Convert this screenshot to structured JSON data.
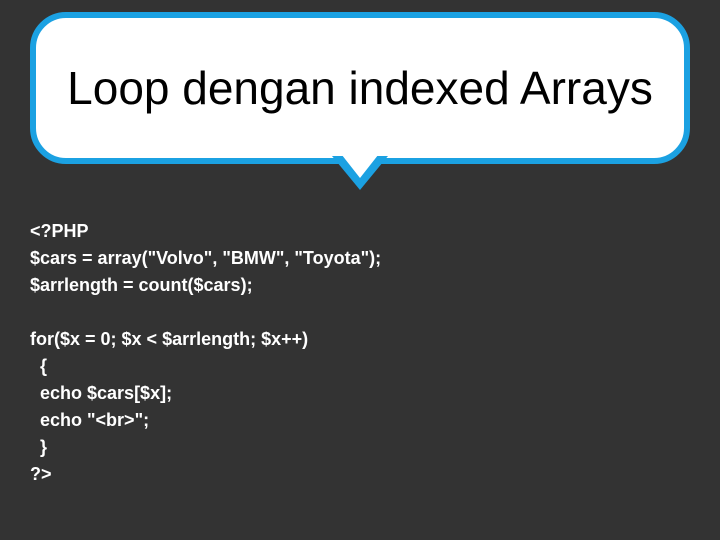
{
  "title": "Loop dengan indexed Arrays",
  "code": {
    "l1": "<?PHP",
    "l2": "$cars = array(\"Volvo\", \"BMW\", \"Toyota\");",
    "l3": "$arrlength = count($cars);",
    "l4": "",
    "l5": "for($x = 0; $x < $arrlength; $x++)",
    "l6": "  {",
    "l7": "  echo $cars[$x];",
    "l8": "  echo \"<br>\";",
    "l9": "  }",
    "l10": "?>"
  }
}
